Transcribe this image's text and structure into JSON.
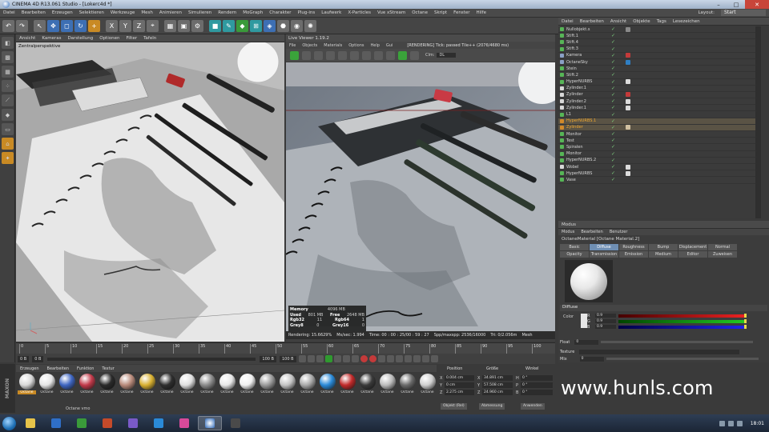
{
  "window": {
    "title": "CINEMA 4D R13.061 Studio - [Lokerc4d *]",
    "min": "–",
    "max": "□",
    "close": "✕"
  },
  "menu": [
    "Datei",
    "Bearbeiten",
    "Erzeugen",
    "Selektieren",
    "Werkzeuge",
    "Mesh",
    "Animieren",
    "Simulieren",
    "Rendern",
    "MoGraph",
    "Charakter",
    "Plug-ins",
    "Laufwerk",
    "X-Particles",
    "Vue xStream",
    "Octane",
    "Skript",
    "Fenster",
    "Hilfe"
  ],
  "layout": {
    "label": "Layout:",
    "value": "Start"
  },
  "viewport": {
    "menu": [
      "Ansicht",
      "Kameras",
      "Darstellung",
      "Optionen",
      "Filter",
      "Tafeln"
    ],
    "camera_label": "Zentralperspektive"
  },
  "render_viewer": {
    "title": "Live Viewer 1.19.2",
    "menu": [
      "File",
      "Objects",
      "Materials",
      "Options",
      "Help",
      "Gui"
    ],
    "info": "[RENDERING] Tick: passed Tile++ (2076/4680 ms)",
    "clm_label": "Clm:",
    "clm_value": "DL",
    "memory": {
      "title": "Memory",
      "title_val": "4096 MB",
      "used_k": "Used",
      "used_v": "801 MB",
      "free_k": "Free",
      "free_v": "2648 MB",
      "rgb32_k": "Rgb32",
      "rgb32_v": "11",
      "rgb64_k": "Rgb64",
      "rgb64_v": "1",
      "grey8_k": "Grey8",
      "grey8_v": "0",
      "grey16_k": "Grey16",
      "grey16_v": "0"
    },
    "status": {
      "rendering": "Rendering: 15.6629%",
      "ms": "Ms/sec: 1.994",
      "time": "Time: 00 : 00 : 25/00 : 59 : 27",
      "spp": "Spp/maxspp: 2536/16000",
      "tri": "Tri: 0/2.056m",
      "mesh": "Mesh"
    }
  },
  "object_manager": {
    "menu": [
      "Datei",
      "Bearbeiten",
      "Ansicht",
      "Objekte",
      "Tags",
      "Lesezeichen"
    ],
    "items": [
      {
        "name": "Nullobjekt.s",
        "type": "n",
        "sel": false,
        "tag": "#8a8a8a"
      },
      {
        "name": "Stift.1",
        "type": "n",
        "sel": false,
        "tag": ""
      },
      {
        "name": "Stift.4",
        "type": "n",
        "sel": false,
        "tag": ""
      },
      {
        "name": "Stift.3",
        "type": "n",
        "sel": false,
        "tag": ""
      },
      {
        "name": "Kamera",
        "type": "c",
        "sel": false,
        "tag": "#c43a3a"
      },
      {
        "name": "OctaneSky",
        "type": "c",
        "sel": false,
        "tag": "#2f7fc4"
      },
      {
        "name": "Stein",
        "type": "n",
        "sel": false,
        "tag": ""
      },
      {
        "name": "Stift.2",
        "type": "n",
        "sel": false,
        "tag": ""
      },
      {
        "name": "HyperNURBS",
        "type": "n",
        "sel": false,
        "tag": "#dcdcdc"
      },
      {
        "name": "Zylinder.1",
        "type": "l",
        "sel": false,
        "tag": ""
      },
      {
        "name": "Zylinder",
        "type": "l",
        "sel": false,
        "tag": "#c43a3a"
      },
      {
        "name": "Zylinder.2",
        "type": "l",
        "sel": false,
        "tag": "#dcdcdc"
      },
      {
        "name": "Zylinder.1",
        "type": "l",
        "sel": false,
        "tag": "#dcdcdc"
      },
      {
        "name": "L1",
        "type": "n",
        "sel": false,
        "tag": ""
      },
      {
        "name": "HyperNURBS.1",
        "type": "o",
        "sel": true,
        "tag": ""
      },
      {
        "name": "Zylinder",
        "type": "o",
        "sel": true,
        "tag": "#d0c0a0"
      },
      {
        "name": "Monitor",
        "type": "n",
        "sel": false,
        "tag": ""
      },
      {
        "name": "Test",
        "type": "n",
        "sel": false,
        "tag": ""
      },
      {
        "name": "Spiralen",
        "type": "n",
        "sel": false,
        "tag": ""
      },
      {
        "name": "Monitor",
        "type": "n",
        "sel": false,
        "tag": ""
      },
      {
        "name": "HyperNURBS.2",
        "type": "n",
        "sel": false,
        "tag": ""
      },
      {
        "name": "Wobel",
        "type": "l",
        "sel": false,
        "tag": "#dcdcdc"
      },
      {
        "name": "HyperNURBS",
        "type": "n",
        "sel": false,
        "tag": "#dcdcdc"
      },
      {
        "name": "Vase",
        "type": "n",
        "sel": false,
        "tag": ""
      }
    ]
  },
  "attribute_manager": {
    "menu": [
      "Modus",
      "Bearbeiten",
      "Benutzer"
    ],
    "material_name": "OctaneMaterial [Octane Material.2]",
    "tabs": [
      "Basic",
      "Diffuse",
      "Roughness",
      "Bump",
      "Displacement",
      "Normal",
      "Opacity",
      "Transmission",
      "Emission",
      "Medium",
      "Editor",
      "Zuweisen"
    ],
    "active_tab": "Diffuse",
    "section": "Diffuse",
    "color_label": "Color",
    "r": "0.9",
    "g": "0.9",
    "b": "0.9",
    "float_label": "Float",
    "float_val": "0",
    "texture_label": "Texture",
    "mix_label": "Mix",
    "mix_val": "0"
  },
  "timeline": {
    "ticks": [
      "0",
      "5",
      "10",
      "15",
      "20",
      "25",
      "30",
      "35",
      "40",
      "45",
      "50",
      "55",
      "60",
      "65",
      "70",
      "75",
      "80",
      "85",
      "90",
      "95",
      "100"
    ],
    "start": "0 B",
    "cur": "0 B",
    "end": "100 B",
    "end2": "100 B",
    "frame": "0 B"
  },
  "material_manager": {
    "menu": [
      "Erzeugen",
      "Bearbeiten",
      "Funktion",
      "Textur"
    ],
    "materials": [
      {
        "name": "Octane",
        "color": "#d8d8d8",
        "sel": true
      },
      {
        "name": "Octane",
        "color": "#e6e6e6",
        "sel": false
      },
      {
        "name": "Octane",
        "color": "#3f66c2",
        "sel": false
      },
      {
        "name": "Octane",
        "color": "#c23a4a",
        "sel": false
      },
      {
        "name": "Octane",
        "color": "#2a2a2a",
        "sel": false
      },
      {
        "name": "Octane",
        "color": "#b88a7a",
        "sel": false
      },
      {
        "name": "Octane",
        "color": "#d8b030",
        "sel": false
      },
      {
        "name": "Octane",
        "color": "#2e2e2e",
        "sel": false
      },
      {
        "name": "Octane",
        "color": "#e0e0e0",
        "sel": false
      },
      {
        "name": "Octane",
        "color": "#8a8a8a",
        "sel": false
      },
      {
        "name": "Octane",
        "color": "#e8e8e8",
        "sel": false
      },
      {
        "name": "Octane",
        "color": "#f0f0f0",
        "sel": false
      },
      {
        "name": "Octane",
        "color": "#9a9a9a",
        "sel": false
      },
      {
        "name": "Octane",
        "color": "#c4c4c4",
        "sel": false
      },
      {
        "name": "Octane",
        "color": "#a8a8a8",
        "sel": false
      },
      {
        "name": "Octane",
        "color": "#2a8ad8",
        "sel": false
      },
      {
        "name": "Octane",
        "color": "#c22a2a",
        "sel": false
      },
      {
        "name": "Octane",
        "color": "#3a3a3a",
        "sel": false
      },
      {
        "name": "Octane",
        "color": "#bcbcbc",
        "sel": false
      },
      {
        "name": "Octane",
        "color": "#6a6a6a",
        "sel": false
      },
      {
        "name": "Octane",
        "color": "#cfcfcf",
        "sel": false
      }
    ],
    "status": "Octane vmo"
  },
  "coordinates": {
    "headers": [
      "Position",
      "Größe",
      "Winkel"
    ],
    "x": "X",
    "y": "Y",
    "z": "Z",
    "px": "0.004 cm",
    "py": "0 cm",
    "pz": "2.275 cm",
    "sx": "34.891 cm",
    "sy": "57.508 cm",
    "sz": "24.960 cm",
    "h": "H",
    "p": "P",
    "b": "B",
    "rh": "0 °",
    "rp": "0 °",
    "rb": "0 °",
    "sx_l": "X",
    "sy_l": "Y",
    "sz_l": "Z",
    "mode1": "Objekt (Rel)",
    "mode2": "Abmessung",
    "apply": "Anwenden"
  },
  "watermark": "www.hunls.com",
  "sidebar_logo": "MAXON",
  "taskbar": {
    "clock": "18:01"
  }
}
